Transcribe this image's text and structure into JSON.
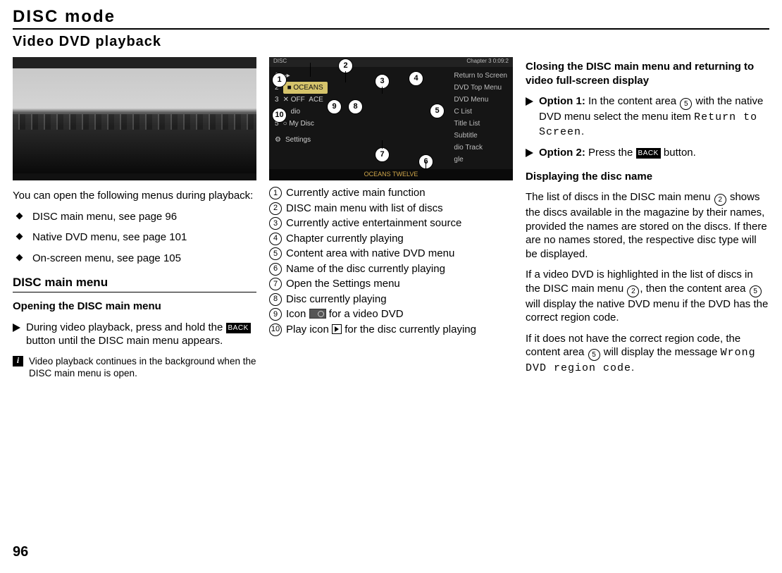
{
  "header": {
    "chapter": "DISC mode",
    "section": "Video DVD playback"
  },
  "col1": {
    "intro": "You can open the following menus during playback:",
    "bullets": [
      "DISC main menu, see page 96",
      "Native DVD menu, see page 101",
      "On-screen menu, see page 105"
    ],
    "h3": "DISC main menu",
    "h4": "Opening the DISC main menu",
    "step_pre": "During video playback, press and hold the ",
    "step_back": "BACK",
    "step_post": " button until the DISC main menu appears.",
    "note": "Video playback continues in the background when the DISC main menu is open."
  },
  "col2": {
    "annot": {
      "top_left": "DISC",
      "top_right": "Chapter 3        0:09:2",
      "left_items": [
        {
          "num": "1",
          "icon": "▸",
          "label": ""
        },
        {
          "num": "2",
          "icon": "",
          "label": "OCEANS",
          "sel": true
        },
        {
          "num": "3",
          "icon": "",
          "label": "OFF   ACE"
        },
        {
          "num": "4",
          "icon": "",
          "label": "   dio"
        },
        {
          "num": "5",
          "icon": "",
          "label": "My Disc"
        },
        {
          "num": "6",
          "icon": "",
          "label": "Settings"
        }
      ],
      "right_items": [
        "Return to Screen",
        "DVD Top Menu",
        "DVD Menu",
        "C         List",
        "Title List",
        "Subtitle",
        "   dio Track",
        "   gle"
      ],
      "footer_text": "OCEANS TWELVE"
    },
    "legend": [
      "Currently active main function",
      "DISC main menu with list of discs",
      "Currently active entertainment source",
      "Chapter currently playing",
      "Content area with native DVD menu",
      "Name of the disc currently playing",
      "Open the Settings menu",
      "Disc currently playing",
      "Icon |DVD| for a video DVD",
      "Play icon |PLAY| for the disc currently playing"
    ]
  },
  "col3": {
    "h4a": "Closing the DISC main menu and returning to video full-screen display",
    "opt1_pre": "Option 1:",
    "opt1_body_a": " In the content area ",
    "opt1_body_b": " with the native DVD menu select the menu item ",
    "opt1_menuitem": "Return to Screen",
    "opt2_pre": "Option 2:",
    "opt2_body_a": " Press the ",
    "opt2_back": "BACK",
    "opt2_body_b": " button.",
    "h4b": "Displaying the disc name",
    "para1_a": "The list of discs in the DISC main menu ",
    "para1_b": " shows the discs available in the magazine by their names, provided the names are stored on the discs. If there are no names stored, the respective disc type will be displayed.",
    "para2_a": "If a video DVD is highlighted in the list of discs in the DISC main menu ",
    "para2_b": ", then the content area ",
    "para2_c": " will display the native DVD menu if the DVD has the correct region code.",
    "para3_a": "If it does not have the correct region code, the content area ",
    "para3_b": " will display the message ",
    "para3_msg": "Wrong DVD region code",
    "para3_c": "."
  },
  "page_number": "96"
}
